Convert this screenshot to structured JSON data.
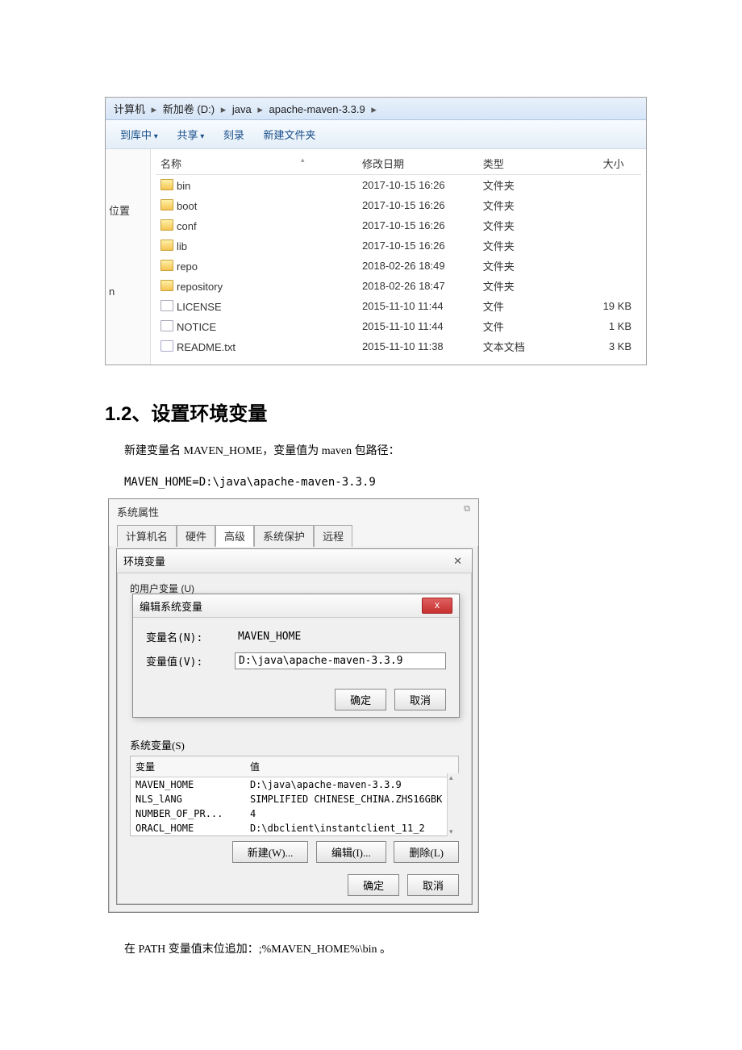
{
  "explorer": {
    "breadcrumb": [
      "计算机",
      "新加卷 (D:)",
      "java",
      "apache-maven-3.3.9"
    ],
    "toolbar": {
      "add_to_library": "到库中",
      "share": "共享",
      "burn": "刻录",
      "new_folder": "新建文件夹"
    },
    "sidebar": {
      "location": "位置",
      "n": "n"
    },
    "columns": {
      "name": "名称",
      "modified": "修改日期",
      "type": "类型",
      "size": "大小"
    },
    "rows": [
      {
        "name": "bin",
        "modified": "2017-10-15 16:26",
        "type": "文件夹",
        "size": "",
        "icon": "folder"
      },
      {
        "name": "boot",
        "modified": "2017-10-15 16:26",
        "type": "文件夹",
        "size": "",
        "icon": "folder"
      },
      {
        "name": "conf",
        "modified": "2017-10-15 16:26",
        "type": "文件夹",
        "size": "",
        "icon": "folder"
      },
      {
        "name": "lib",
        "modified": "2017-10-15 16:26",
        "type": "文件夹",
        "size": "",
        "icon": "folder"
      },
      {
        "name": "repo",
        "modified": "2018-02-26 18:49",
        "type": "文件夹",
        "size": "",
        "icon": "folder"
      },
      {
        "name": "repository",
        "modified": "2018-02-26 18:47",
        "type": "文件夹",
        "size": "",
        "icon": "folder"
      },
      {
        "name": "LICENSE",
        "modified": "2015-11-10 11:44",
        "type": "文件",
        "size": "19 KB",
        "icon": "file"
      },
      {
        "name": "NOTICE",
        "modified": "2015-11-10 11:44",
        "type": "文件",
        "size": "1 KB",
        "icon": "file"
      },
      {
        "name": "README.txt",
        "modified": "2015-11-10 11:38",
        "type": "文本文档",
        "size": "3 KB",
        "icon": "txt"
      }
    ]
  },
  "section": {
    "heading": "1.2、设置环境变量",
    "line1": "新建变量名 MAVEN_HOME，变量值为 maven 包路径：",
    "line2": "MAVEN_HOME=D:\\java\\apache-maven-3.3.9"
  },
  "sysprop": {
    "title": "系统属性",
    "tabs": {
      "computer_name": "计算机名",
      "hardware": "硬件",
      "advanced": "高级",
      "system_protection": "系统保护",
      "remote": "远程"
    }
  },
  "envvar": {
    "title": "环境变量",
    "user_group": "的用户变量 (U)",
    "sysvar_label": "系统变量(S)",
    "col_var": "变量",
    "col_val": "值",
    "rows": [
      {
        "var": "MAVEN_HOME",
        "val": "D:\\java\\apache-maven-3.3.9"
      },
      {
        "var": "NLS_lANG",
        "val": "SIMPLIFIED CHINESE_CHINA.ZHS16GBK"
      },
      {
        "var": "NUMBER_OF_PR...",
        "val": "4"
      },
      {
        "var": "ORACL_HOME",
        "val": "D:\\dbclient\\instantclient_11_2"
      }
    ],
    "btn_new": "新建(W)...",
    "btn_edit": "编辑(I)...",
    "btn_delete": "删除(L)",
    "btn_ok": "确定",
    "btn_cancel": "取消"
  },
  "editvar": {
    "title": "编辑系统变量",
    "label_name": "变量名(N):",
    "label_value": "变量值(V):",
    "value_name": "MAVEN_HOME",
    "value_value": "D:\\java\\apache-maven-3.3.9",
    "btn_ok": "确定",
    "btn_cancel": "取消",
    "close_x": "x"
  },
  "trailing": {
    "text": "在 PATH 变量值末位追加：;%MAVEN_HOME%\\bin 。"
  }
}
